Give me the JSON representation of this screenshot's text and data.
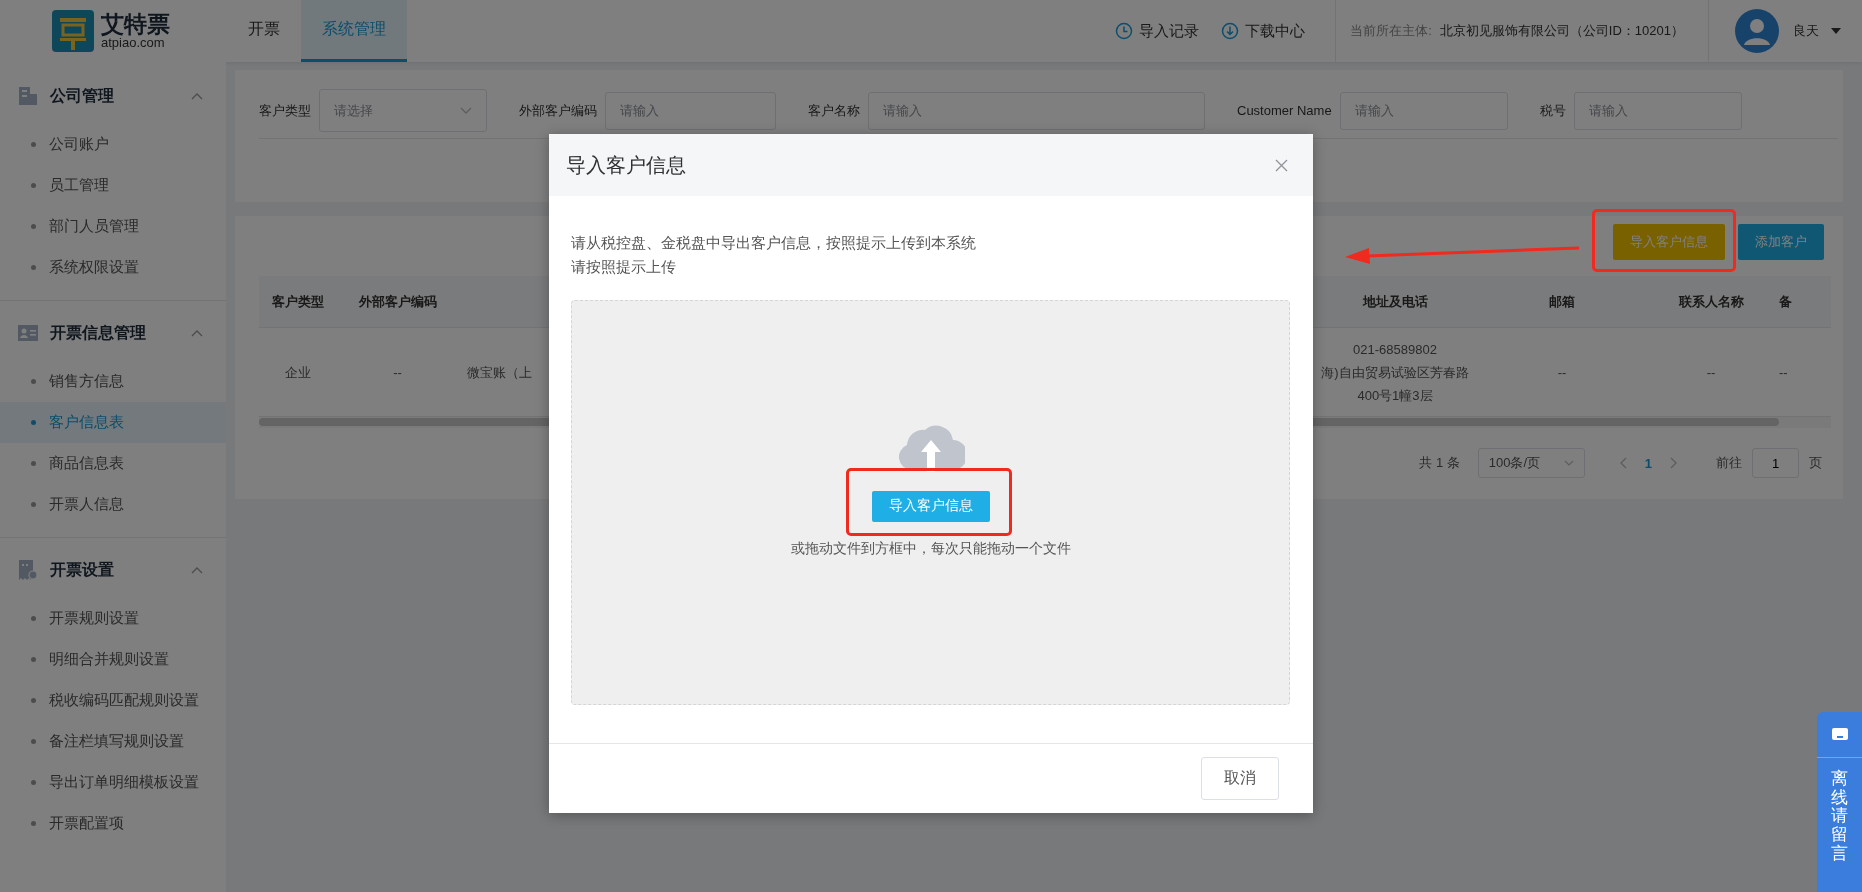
{
  "header": {
    "brand": "艾特票",
    "domain": "atpiao.com",
    "tabs": [
      {
        "label": "开票",
        "selected": false
      },
      {
        "label": "系统管理",
        "selected": true
      }
    ],
    "actions": [
      {
        "label": "导入记录"
      },
      {
        "label": "下载中心"
      }
    ],
    "entity_label": "当前所在主体:",
    "entity_name": "北京初见服饰有限公司（公司ID：10201）",
    "user": "良天"
  },
  "sidebar": {
    "groups": [
      {
        "title": "公司管理",
        "expanded": true,
        "items": [
          {
            "label": "公司账户",
            "selected": false
          },
          {
            "label": "员工管理",
            "selected": false
          },
          {
            "label": "部门人员管理",
            "selected": false
          },
          {
            "label": "系统权限设置",
            "selected": false
          }
        ]
      },
      {
        "title": "开票信息管理",
        "expanded": true,
        "items": [
          {
            "label": "销售方信息",
            "selected": false
          },
          {
            "label": "客户信息表",
            "selected": true
          },
          {
            "label": "商品信息表",
            "selected": false
          },
          {
            "label": "开票人信息",
            "selected": false
          }
        ]
      },
      {
        "title": "开票设置",
        "expanded": true,
        "items": [
          {
            "label": "开票规则设置",
            "selected": false
          },
          {
            "label": "明细合并规则设置",
            "selected": false
          },
          {
            "label": "税收编码匹配规则设置",
            "selected": false
          },
          {
            "label": "备注栏填写规则设置",
            "selected": false
          },
          {
            "label": "导出订单明细模板设置",
            "selected": false
          },
          {
            "label": "开票配置项",
            "selected": false
          }
        ]
      }
    ]
  },
  "filters": [
    {
      "label": "客户类型",
      "kind": "select",
      "placeholder": "请选择"
    },
    {
      "label": "外部客户编码",
      "kind": "input",
      "placeholder": "请输入"
    },
    {
      "label": "客户名称",
      "kind": "input",
      "placeholder": "请输入"
    },
    {
      "label": "Customer Name",
      "kind": "input",
      "placeholder": "请输入"
    },
    {
      "label": "税号",
      "kind": "input",
      "placeholder": "请输入"
    }
  ],
  "table_actions": [
    {
      "label": "导入客户信息",
      "kind": "warning"
    },
    {
      "label": "添加客户",
      "kind": "primary"
    }
  ],
  "table": {
    "columns": [
      {
        "label": "客户类型"
      },
      {
        "label": "外部客户编码"
      },
      {},
      {
        "label": "地址及电话"
      },
      {
        "label": "邮箱"
      },
      {
        "label": "联系人名称"
      },
      {
        "label": "备"
      }
    ],
    "rows": [
      {
        "cells": [
          "企业",
          "--",
          "微宝账（上",
          "021-68589802\n海)自由贸易试验区芳春路\n400号1幢3层",
          "--",
          "--",
          "--"
        ]
      }
    ]
  },
  "pagination": {
    "total": "共 1 条",
    "page_size": "100条/页",
    "pages": [
      {
        "label": "1",
        "selected": true
      }
    ],
    "goto_label": "前往",
    "goto_value": "1",
    "page_suffix": "页"
  },
  "modal": {
    "title": "导入客户信息",
    "description": [
      "请从税控盘、金税盘中导出客户信息，按照提示上传到本系统",
      "请按照提示上传"
    ],
    "upload_button": "导入客户信息",
    "hint": "或拖动文件到方框中，每次只能拖动一个文件",
    "cancel": "取消"
  },
  "float_widget": {
    "label": "离线请留言"
  }
}
